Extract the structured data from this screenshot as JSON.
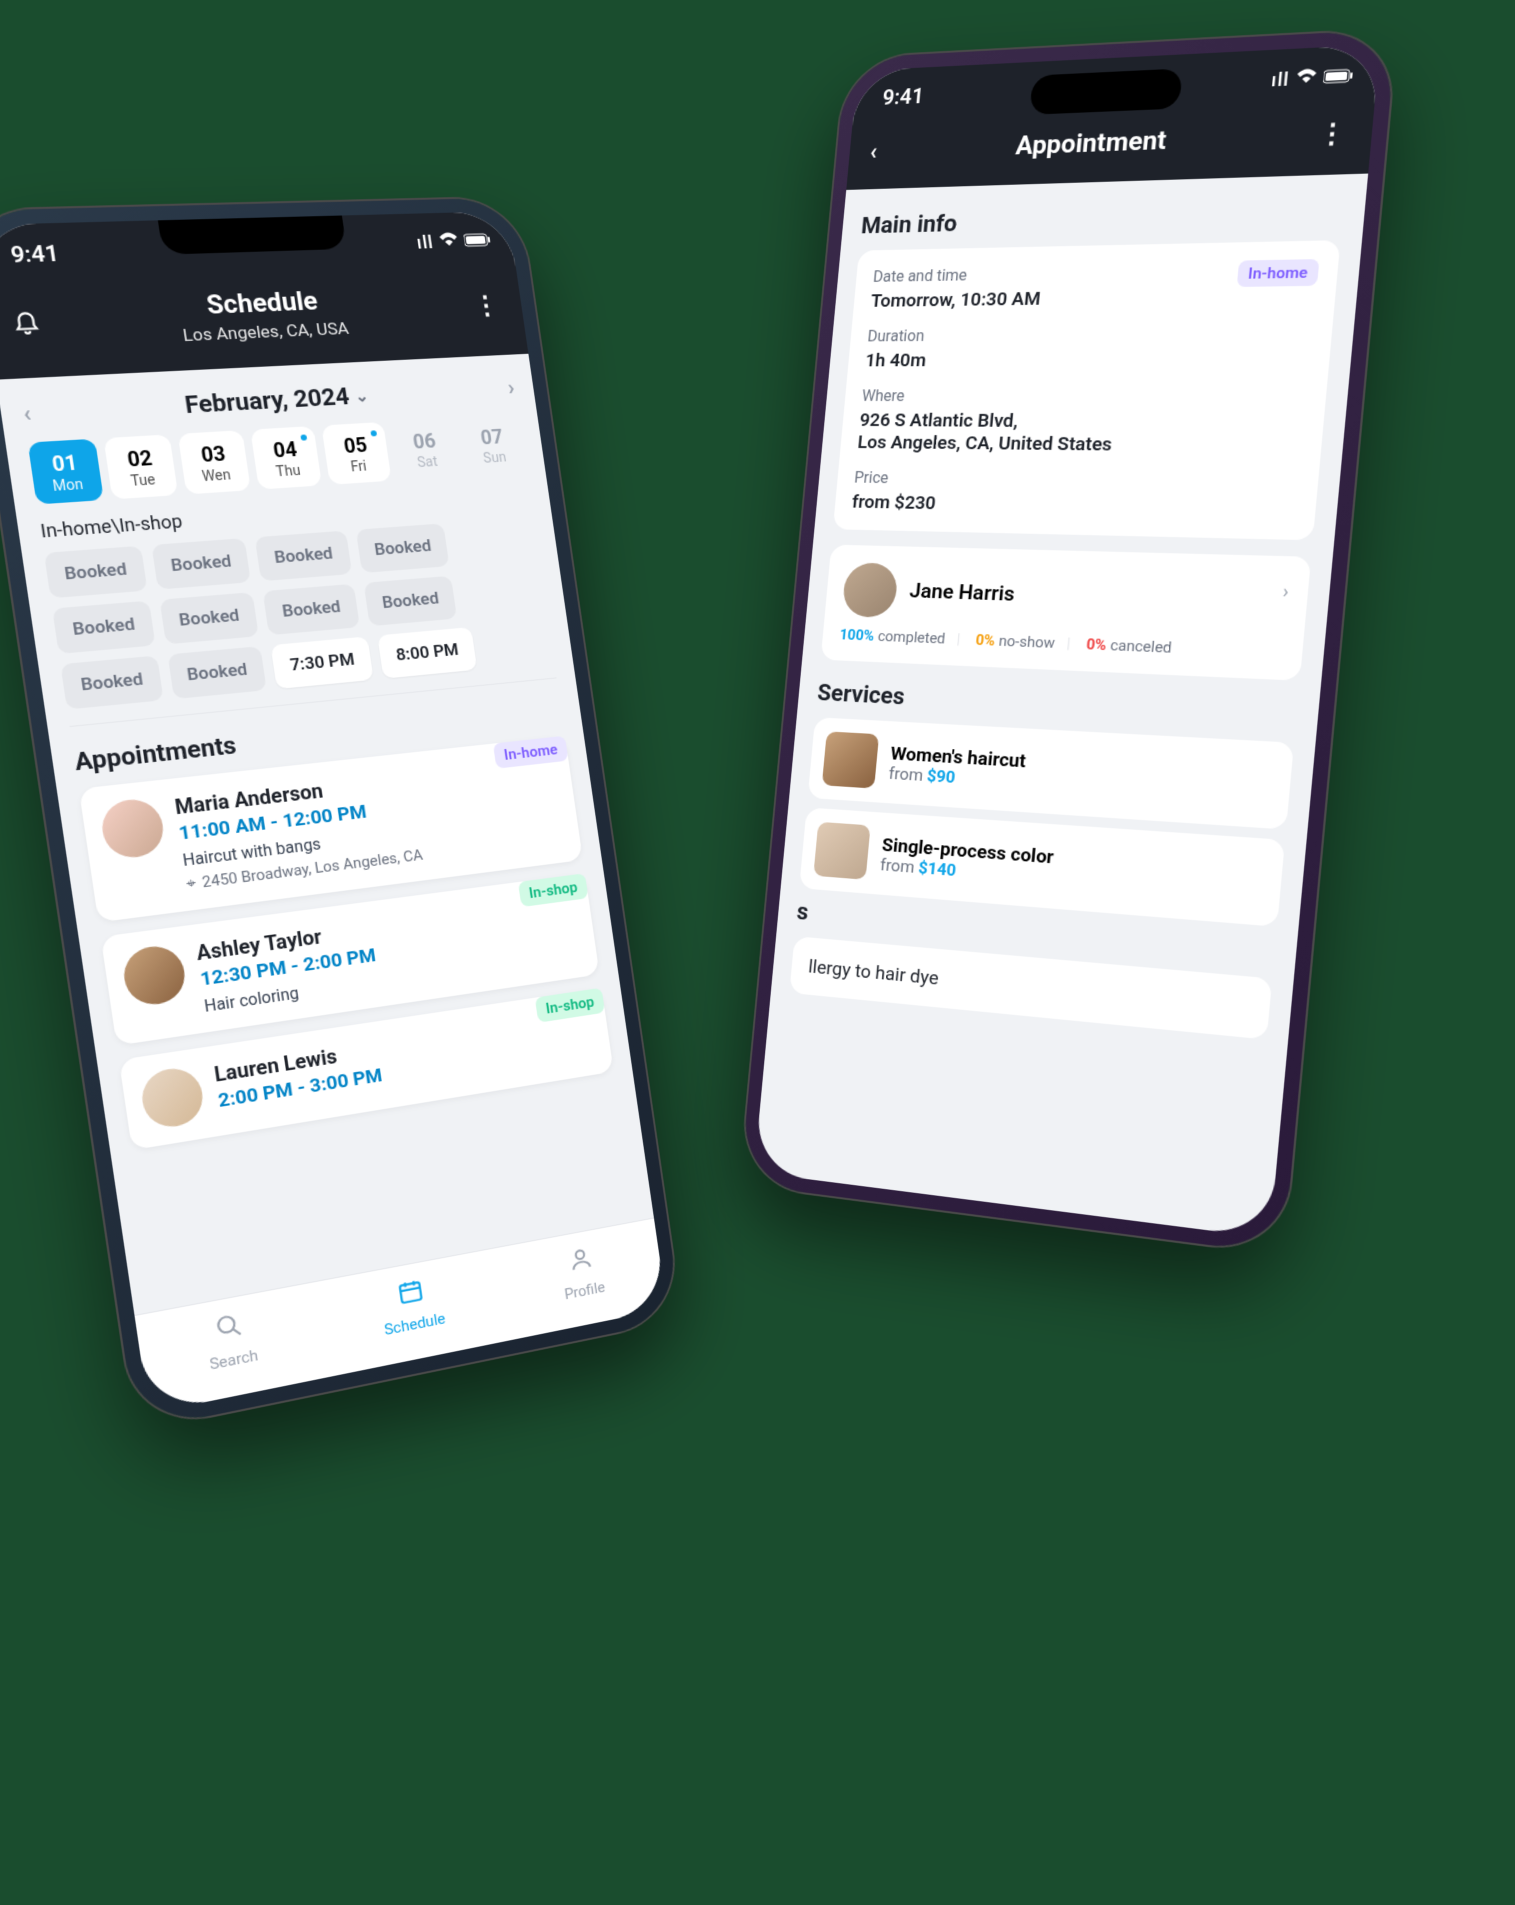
{
  "status": {
    "time": "9:41"
  },
  "left": {
    "header": {
      "title": "Schedule",
      "subtitle": "Los Angeles, CA, USA"
    },
    "month": "February, 2024",
    "days": [
      {
        "num": "01",
        "name": "Mon",
        "selected": true,
        "dot": false,
        "ghost": false
      },
      {
        "num": "02",
        "name": "Tue",
        "selected": false,
        "dot": false,
        "ghost": false
      },
      {
        "num": "03",
        "name": "Wen",
        "selected": false,
        "dot": false,
        "ghost": false
      },
      {
        "num": "04",
        "name": "Thu",
        "selected": false,
        "dot": true,
        "ghost": false
      },
      {
        "num": "05",
        "name": "Fri",
        "selected": false,
        "dot": true,
        "ghost": false
      },
      {
        "num": "06",
        "name": "Sat",
        "selected": false,
        "dot": false,
        "ghost": true
      },
      {
        "num": "07",
        "name": "Sun",
        "selected": false,
        "dot": false,
        "ghost": true
      }
    ],
    "slots_label": "In-home\\In-shop",
    "slots": [
      {
        "label": "Booked",
        "open": false
      },
      {
        "label": "Booked",
        "open": false
      },
      {
        "label": "Booked",
        "open": false
      },
      {
        "label": "Booked",
        "open": false
      },
      {
        "label": "Booked",
        "open": false
      },
      {
        "label": "Booked",
        "open": false
      },
      {
        "label": "Booked",
        "open": false
      },
      {
        "label": "Booked",
        "open": false
      },
      {
        "label": "Booked",
        "open": false
      },
      {
        "label": "Booked",
        "open": false
      },
      {
        "label": "7:30 PM",
        "open": true
      },
      {
        "label": "8:00 PM",
        "open": true
      }
    ],
    "apts_title": "Appointments",
    "apts": [
      {
        "name": "Maria Anderson",
        "time": "11:00 AM - 12:00 PM",
        "service": "Haircut with bangs",
        "address": "2450 Broadway, Los Angeles, CA",
        "badge": "In-home"
      },
      {
        "name": "Ashley Taylor",
        "time": "12:30 PM - 2:00 PM",
        "service": "Hair coloring",
        "address": "",
        "badge": "In-shop"
      },
      {
        "name": "Lauren Lewis",
        "time": "2:00 PM - 3:00 PM",
        "service": "",
        "address": "",
        "badge": "In-shop"
      }
    ],
    "tabs": {
      "search": "Search",
      "schedule": "Schedule",
      "profile": "Profile"
    }
  },
  "right": {
    "header": {
      "title": "Appointment"
    },
    "main_info_title": "Main info",
    "info": {
      "datetime_label": "Date and time",
      "datetime_value": "Tomorrow, 10:30 AM",
      "badge": "In-home",
      "duration_label": "Duration",
      "duration_value": "1h 40m",
      "where_label": "Where",
      "where_value_l1": "926 S Atlantic Blvd,",
      "where_value_l2": "Los Angeles, CA, United States",
      "price_label": "Price",
      "price_value": "from $230"
    },
    "client": {
      "name": "Jane Harris",
      "stats": {
        "completed_v": "100%",
        "completed_l": "completed",
        "noshow_v": "0%",
        "noshow_l": "no-show",
        "canceled_v": "0%",
        "canceled_l": "canceled"
      }
    },
    "services_title": "Services",
    "services": [
      {
        "name": "Women's haircut",
        "from": "from ",
        "price": "$90"
      },
      {
        "name": "Single-process color",
        "from": "from ",
        "price": "$140"
      }
    ],
    "notes_title": "s",
    "notes_value": "llergy to hair dye"
  }
}
